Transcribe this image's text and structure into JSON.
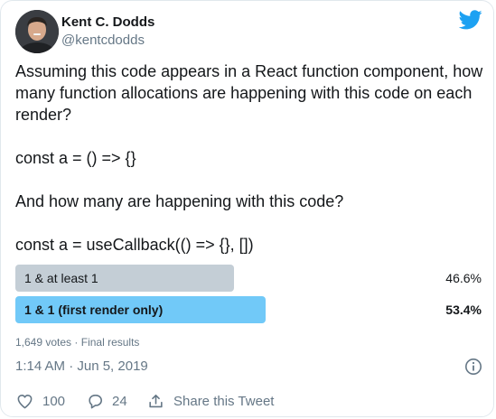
{
  "author": {
    "name": "Kent C. Dodds",
    "handle": "@kentcdodds"
  },
  "brand_icon": "twitter-bird-icon",
  "colors": {
    "brand": "#1da1f2",
    "poll_winner": "#71c9f8",
    "poll_other": "#c4ced6",
    "secondary_text": "#657786"
  },
  "tweet": {
    "text": "Assuming this code appears in a React function component, how many function allocations are happening with this code on each render?\n\nconst a = () => {}\n\nAnd how many are happening with this code?\n\nconst a = useCallback(() => {}, [])"
  },
  "poll": {
    "options": [
      {
        "label": "1 & at least 1",
        "percent_text": "46.6%",
        "percent": 46.6,
        "winner": false
      },
      {
        "label": "1 & 1 (first render only)",
        "percent_text": "53.4%",
        "percent": 53.4,
        "winner": true
      }
    ],
    "votes": "1,649 votes",
    "separator": "·",
    "status": "Final results"
  },
  "timestamp": "1:14 AM · Jun 5, 2019",
  "actions": {
    "likes": "100",
    "replies": "24",
    "share_label": "Share this Tweet"
  }
}
